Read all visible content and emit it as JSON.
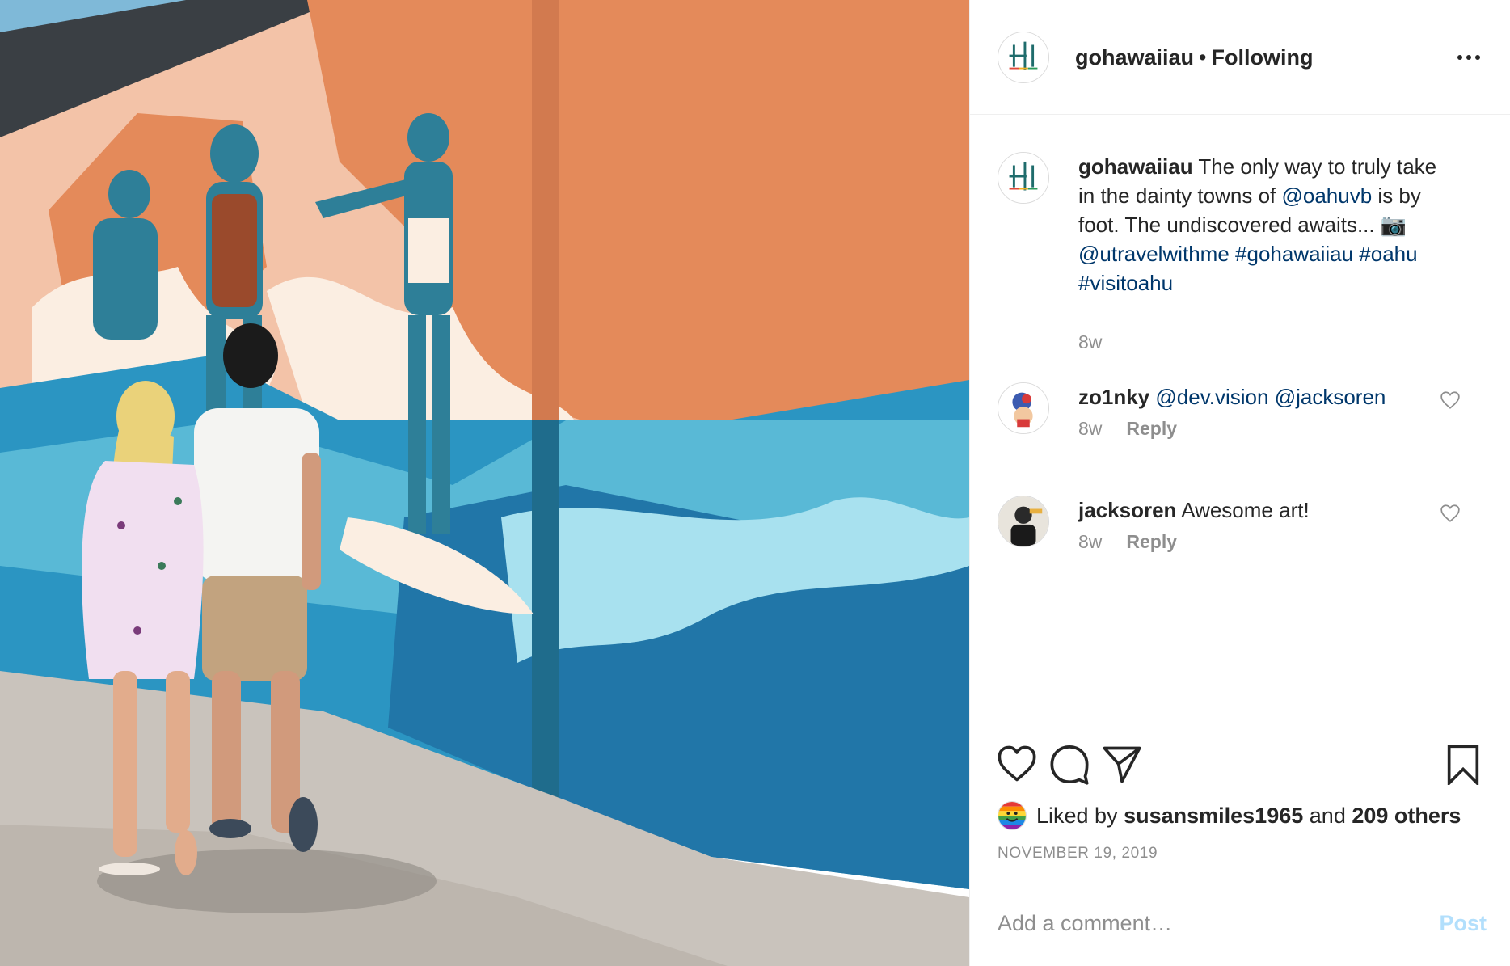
{
  "post": {
    "author": "gohawaiiau",
    "separator": "•",
    "follow_status": "Following",
    "more_icon": "more-dots-icon"
  },
  "caption": {
    "username": "gohawaiiau",
    "text_1": " The only way to truly take in the dainty towns of ",
    "mention_1": "@oahuvb",
    "text_2": " is by foot. The undiscovered awaits... ",
    "camera_emoji": "📷",
    "mention_2": "@utravelwithme",
    "hashtag_1": "#gohawaiiau",
    "hashtag_2": "#oahu",
    "hashtag_3": "#visitoahu",
    "time": "8w"
  },
  "comments": [
    {
      "username": "zo1nky",
      "mention_1": "@dev.vision",
      "mention_2": "@jacksoren",
      "time": "8w",
      "reply": "Reply"
    },
    {
      "username": "jacksoren",
      "text": "Awesome art!",
      "time": "8w",
      "reply": "Reply"
    }
  ],
  "likes": {
    "prefix": "Liked by",
    "user": "susansmiles1965",
    "and": "and",
    "others": "209 others"
  },
  "date": "NOVEMBER 19, 2019",
  "add_comment": {
    "placeholder": "Add a comment…",
    "post_label": "Post"
  },
  "colors": {
    "link": "#00376b",
    "muted": "#8e8e8e",
    "post_disabled": "#b2dffc",
    "mural_orange": "#e48a5a",
    "mural_teal": "#2e7f98",
    "mural_blue": "#2b95c2"
  }
}
